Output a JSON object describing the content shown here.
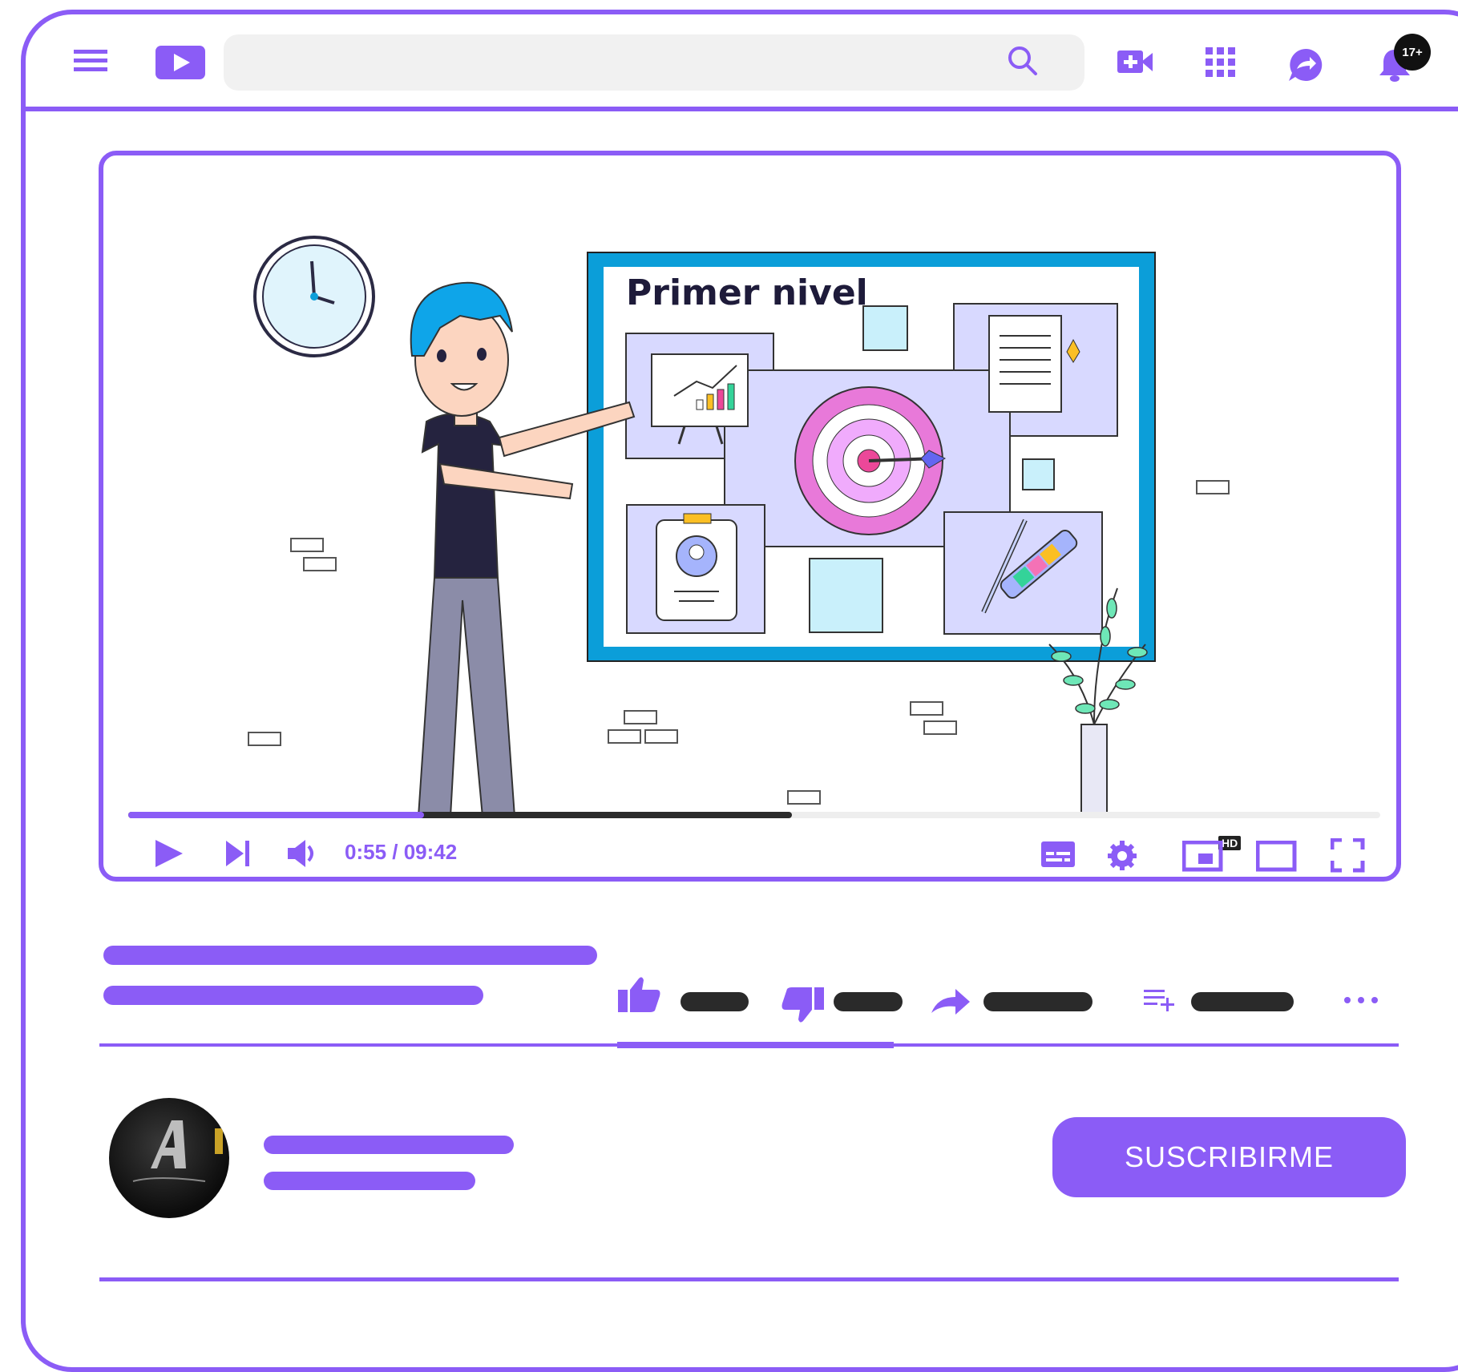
{
  "header": {
    "notification_badge": "17+",
    "icons": [
      "menu-icon",
      "logo-play-icon",
      "search-icon",
      "create-video-icon",
      "apps-grid-icon",
      "messages-icon",
      "bell-icon"
    ]
  },
  "player": {
    "slide_title": "Primer nivel",
    "time_display": "0:55 / 09:42",
    "quality_badge": "HD",
    "progress": {
      "played_fraction": 0.236,
      "buffered_fraction": 0.53
    }
  },
  "actions": {
    "icons": [
      "like-icon",
      "dislike-icon",
      "share-icon",
      "save-playlist-icon",
      "more-icon"
    ],
    "more_label": "···"
  },
  "channel": {
    "subscribe_label": "SUSCRIBIRME"
  },
  "colors": {
    "accent": "#8b5cf6",
    "dark": "#2a2a2a",
    "board_frame": "#0b9ed9",
    "hair": "#0ea5e9"
  }
}
